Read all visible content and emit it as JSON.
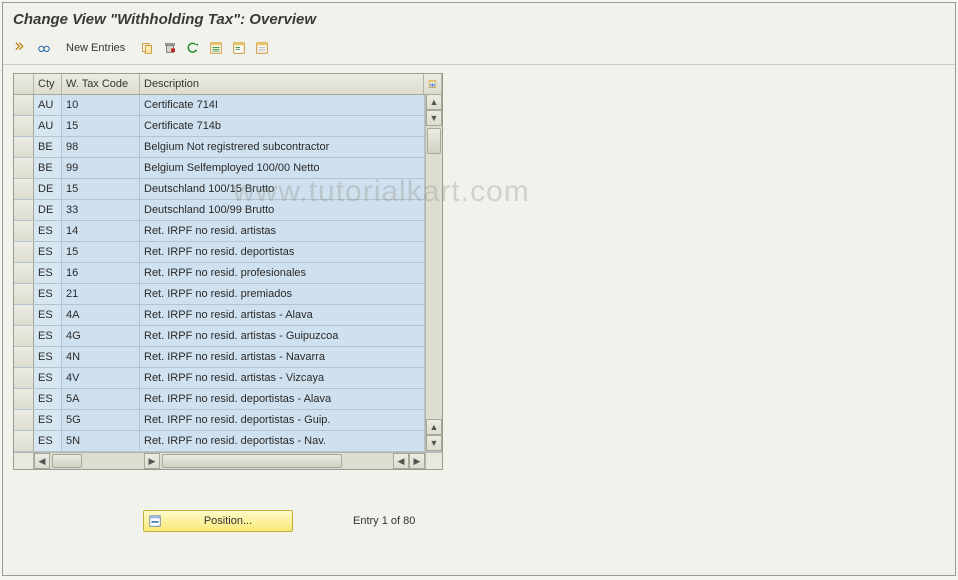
{
  "title": "Change View \"Withholding Tax\": Overview",
  "toolbar": {
    "new_entries_label": "New Entries"
  },
  "watermark": "www.tutorialkart.com",
  "grid": {
    "headers": {
      "cty": "Cty",
      "code": "W. Tax Code",
      "desc": "Description"
    },
    "rows": [
      {
        "cty": "AU",
        "code": "10",
        "desc": "Certificate 714I"
      },
      {
        "cty": "AU",
        "code": "15",
        "desc": "Certificate 714b"
      },
      {
        "cty": "BE",
        "code": "98",
        "desc": "Belgium Not registrered subcontractor"
      },
      {
        "cty": "BE",
        "code": "99",
        "desc": "Belgium Selfemployed 100/00 Netto"
      },
      {
        "cty": "DE",
        "code": "15",
        "desc": "Deutschland 100/15 Brutto"
      },
      {
        "cty": "DE",
        "code": "33",
        "desc": "Deutschland 100/99 Brutto"
      },
      {
        "cty": "ES",
        "code": "14",
        "desc": "Ret. IRPF no resid. artistas"
      },
      {
        "cty": "ES",
        "code": "15",
        "desc": "Ret. IRPF no resid. deportistas"
      },
      {
        "cty": "ES",
        "code": "16",
        "desc": "Ret. IRPF no resid. profesionales"
      },
      {
        "cty": "ES",
        "code": "21",
        "desc": "Ret. IRPF no resid. premiados"
      },
      {
        "cty": "ES",
        "code": "4A",
        "desc": "Ret. IRPF no resid. artistas - Alava"
      },
      {
        "cty": "ES",
        "code": "4G",
        "desc": "Ret. IRPF no resid. artistas - Guipuzcoa"
      },
      {
        "cty": "ES",
        "code": "4N",
        "desc": "Ret. IRPF no resid. artistas - Navarra"
      },
      {
        "cty": "ES",
        "code": "4V",
        "desc": "Ret. IRPF no resid. artistas - Vizcaya"
      },
      {
        "cty": "ES",
        "code": "5A",
        "desc": "Ret. IRPF no resid. deportistas - Alava"
      },
      {
        "cty": "ES",
        "code": "5G",
        "desc": "Ret. IRPF no resid. deportistas - Guip."
      },
      {
        "cty": "ES",
        "code": "5N",
        "desc": "Ret. IRPF no resid. deportistas - Nav."
      }
    ]
  },
  "footer": {
    "position_label": "Position...",
    "entry_text": "Entry 1 of 80"
  }
}
